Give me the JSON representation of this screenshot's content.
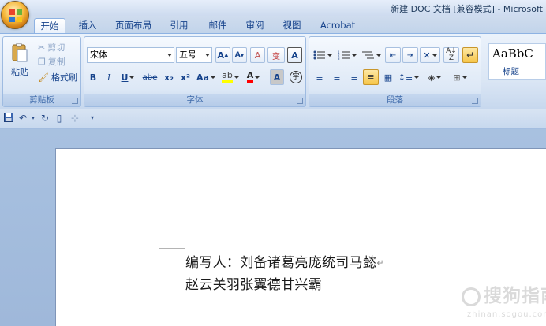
{
  "title": "新建 DOC 文档 [兼容模式] - Microsoft",
  "tabs": [
    {
      "label": "开始",
      "active": true
    },
    {
      "label": "插入"
    },
    {
      "label": "页面布局"
    },
    {
      "label": "引用"
    },
    {
      "label": "邮件"
    },
    {
      "label": "审阅"
    },
    {
      "label": "视图"
    },
    {
      "label": "Acrobat"
    }
  ],
  "clipboard": {
    "paste": "粘贴",
    "cut": "剪切",
    "copy": "复制",
    "format_painter": "格式刷",
    "group_label": "剪贴板"
  },
  "font": {
    "font_name": "宋体",
    "font_size": "五号",
    "bold": "B",
    "italic": "I",
    "underline": "U",
    "strike": "abe",
    "subscript": "x₂",
    "superscript": "x²",
    "change_case": "Aa",
    "grow": "A",
    "shrink": "A",
    "clear": "A",
    "phonetic": "变",
    "border": "A",
    "shade": "A",
    "enclose": "字",
    "group_label": "字体"
  },
  "paragraph": {
    "group_label": "段落"
  },
  "styles": {
    "sample": "AaBbC",
    "name": "标题"
  },
  "document": {
    "line1": "编写人：刘备诸葛亮庞统司马懿",
    "line2": "赵云关羽张翼德甘兴霸"
  },
  "watermark": {
    "text": "搜狗指南",
    "sub": "zhinan.sogou.com"
  }
}
